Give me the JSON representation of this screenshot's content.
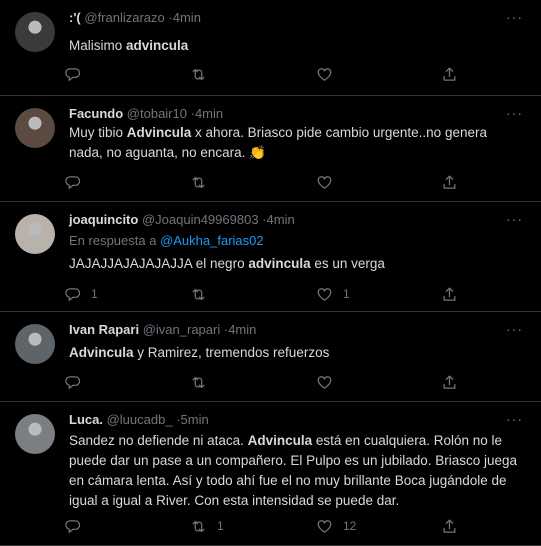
{
  "tweets": [
    {
      "name": ":'(",
      "handle": "@franlizarazo",
      "dot": "·",
      "time": "4min",
      "reply_to_prefix": "",
      "reply_to_handle": "",
      "parts": [
        {
          "text": "Malisimo ",
          "bold": false
        },
        {
          "text": "advincula",
          "bold": true
        }
      ],
      "counts": {
        "reply": "",
        "retweet": "",
        "like": ""
      },
      "avatar_color": "#3a3a3a"
    },
    {
      "name": "Facundo",
      "handle": "@tobair10",
      "dot": "·",
      "time": "4min",
      "reply_to_prefix": "",
      "reply_to_handle": "",
      "parts": [
        {
          "text": "Muy tibio ",
          "bold": false
        },
        {
          "text": "Advincula",
          "bold": true
        },
        {
          "text": " x ahora. Briasco pide cambio urgente..no genera nada, no aguanta, no encara. ",
          "bold": false
        },
        {
          "text": "👏",
          "bold": false
        }
      ],
      "counts": {
        "reply": "",
        "retweet": "",
        "like": ""
      },
      "avatar_color": "#5a4a40"
    },
    {
      "name": "joaquincito",
      "handle": "@Joaquin49969803",
      "dot": "·",
      "time": "4min",
      "reply_to_prefix": "En respuesta a ",
      "reply_to_handle": "@Aukha_farias02",
      "parts": [
        {
          "text": "JAJAJJAJAJAJAJJA el negro ",
          "bold": false
        },
        {
          "text": "advincula",
          "bold": true
        },
        {
          "text": " es un verga",
          "bold": false
        }
      ],
      "counts": {
        "reply": "1",
        "retweet": "",
        "like": "1"
      },
      "avatar_color": "#b8b2ab"
    },
    {
      "name": "Ivan Rapari",
      "handle": "@ivan_rapari",
      "dot": "·",
      "time": "4min",
      "reply_to_prefix": "",
      "reply_to_handle": "",
      "parts": [
        {
          "text": "Advincula",
          "bold": true
        },
        {
          "text": " y Ramirez, tremendos refuerzos",
          "bold": false
        }
      ],
      "counts": {
        "reply": "",
        "retweet": "",
        "like": ""
      },
      "avatar_color": "#5f6468"
    },
    {
      "name": "Luca.",
      "handle": "@luucadb_",
      "dot": "·",
      "time": "5min",
      "reply_to_prefix": "",
      "reply_to_handle": "",
      "parts": [
        {
          "text": "Sandez no defiende ni ataca. ",
          "bold": false
        },
        {
          "text": "Advincula",
          "bold": true
        },
        {
          "text": " está en cualquiera. Rolón no le puede dar un pase a un compañero. El Pulpo es un jubilado. Briasco juega en cámara lenta. Así y todo ahí fue el no muy brillante Boca jugándole de igual a igual a River. Con esta intensidad se puede dar.",
          "bold": false
        }
      ],
      "counts": {
        "reply": "",
        "retweet": "1",
        "like": "12"
      },
      "avatar_color": "#7a7f83"
    }
  ],
  "more_icon": "···",
  "icons": [
    "reply-icon",
    "retweet-icon",
    "like-icon",
    "share-icon"
  ],
  "colors": {
    "background": "#000000",
    "text": "#d9d9d9",
    "muted": "#6e767d",
    "link": "#1d9bf0",
    "divider": "#2f3336"
  }
}
